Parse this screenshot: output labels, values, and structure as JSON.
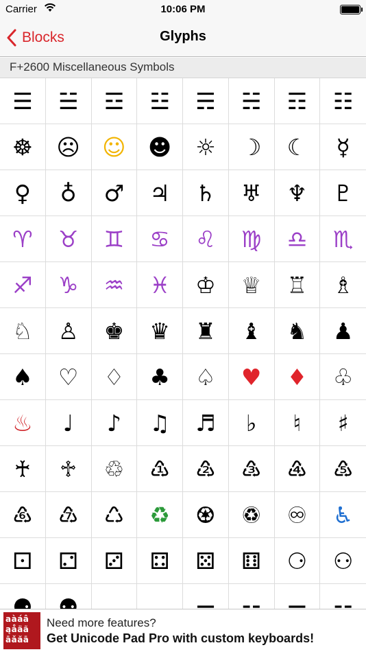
{
  "status_bar": {
    "carrier": "Carrier",
    "time": "10:06 PM"
  },
  "nav": {
    "back_label": "Blocks",
    "title": "Glyphs",
    "accent_color": "#d9262b"
  },
  "section": {
    "title": "F+2600 Miscellaneous Symbols"
  },
  "glyphs": [
    "☰",
    "☱",
    "☲",
    "☳",
    "☴",
    "☵",
    "☶",
    "☷",
    "☸",
    "☹",
    "☺",
    "☻",
    "☼",
    "☽",
    "☾",
    "☿",
    "♀",
    "♁",
    "♂",
    "♃",
    "♄",
    "♅",
    "♆",
    "♇",
    "♈",
    "♉",
    "♊",
    "♋",
    "♌",
    "♍",
    "♎",
    "♏",
    "♐",
    "♑",
    "♒",
    "♓",
    "♔",
    "♕",
    "♖",
    "♗",
    "♘",
    "♙",
    "♚",
    "♛",
    "♜",
    "♝",
    "♞",
    "♟",
    "♠",
    "♡",
    "♢",
    "♣",
    "♤",
    "♥",
    "♦",
    "♧",
    "♨",
    "♩",
    "♪",
    "♫",
    "♬",
    "♭",
    "♮",
    "♯",
    "♰",
    "♱",
    "♲",
    "♳",
    "♴",
    "♵",
    "♶",
    "♷",
    "♸",
    "♹",
    "♺",
    "♻",
    "♼",
    "♽",
    "♾",
    "♿",
    "⚀",
    "⚁",
    "⚂",
    "⚃",
    "⚄",
    "⚅",
    "⚆",
    "⚇",
    "⚈",
    "⚉",
    "⚊",
    "⚋",
    "⚌",
    "⚍",
    "⚎",
    "⚏"
  ],
  "glyph_colors": {
    "zodiac": "#9b3fc7",
    "red_suit": "#e0242b",
    "hot_springs": "#d0262b",
    "recycle_green": "#2c9a3a",
    "wheelchair": "#1f6fd1",
    "smiley": "#f2b400"
  },
  "ad": {
    "logo_lines": [
      "aàáâ",
      "ąåäã",
      "āǎăā"
    ],
    "line1": "Need more features?",
    "line2": "Get Unicode Pad Pro with custom keyboards!"
  }
}
